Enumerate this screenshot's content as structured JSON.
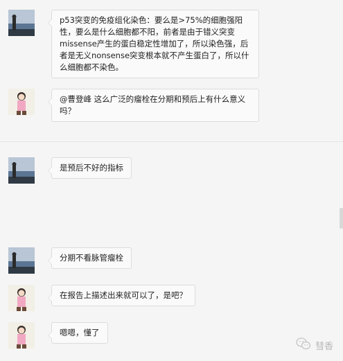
{
  "messages": [
    {
      "avatar": "landscape-avatar",
      "text": "p53突变的免疫组化染色：要么是>75%的细胞强阳性，要么是什么细胞都不阳，前者是由于错义突变missense产生的蛋白稳定性增加了，所以染色强，后者是无义nonsense突变根本就不产生蛋白了，所以什么细胞都不染色。"
    },
    {
      "avatar": "cartoon-avatar",
      "text": "@曹登峰 这么广泛的瘤栓在分期和预后上有什么意义吗？"
    },
    {
      "avatar": "landscape-avatar",
      "text": "是预后不好的指标"
    },
    {
      "avatar": "landscape-avatar",
      "text": "分期不看脉管瘤栓"
    },
    {
      "avatar": "cartoon-avatar",
      "text": "在报告上描述出来就可以了，是吧？"
    },
    {
      "avatar": "cartoon-avatar",
      "text": "嗯嗯，懂了"
    }
  ],
  "watermark": {
    "icon": "wechat-icon",
    "text": "彗香"
  }
}
